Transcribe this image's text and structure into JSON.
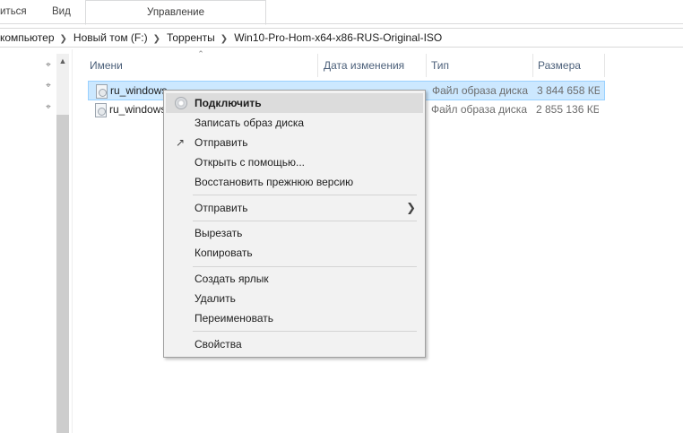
{
  "ribbon": {
    "tabs": [
      "иться",
      "Вид",
      "Управление"
    ]
  },
  "address": {
    "crumbs": [
      "компьютер",
      "Новый том (F:)",
      "Торренты",
      "Win10-Pro-Hom-x64-x86-RUS-Original-ISO"
    ]
  },
  "columns": {
    "name": "Имени",
    "date": "Дата изменения",
    "type": "Тип",
    "size": "Размера"
  },
  "files": [
    {
      "name": "ru_windows",
      "type": "Файл образа диска",
      "size": "3 844 658 КБ",
      "selected": true
    },
    {
      "name": "ru_windows",
      "type": "Файл образа диска",
      "size": "2 855 136 КБ",
      "selected": false
    }
  ],
  "context_menu": {
    "items": [
      {
        "label": "Подключить",
        "icon": "disc-icon"
      },
      {
        "label": "Записать образ диска"
      },
      {
        "label": "Отправить",
        "icon": "share-icon"
      },
      {
        "label": "Открыть с помощью..."
      },
      {
        "label": "Восстановить прежнюю версию"
      },
      {
        "label": "Отправить",
        "submenu": true
      },
      {
        "label": "Вырезать"
      },
      {
        "label": "Копировать"
      },
      {
        "label": "Создать ярлык"
      },
      {
        "label": "Удалить"
      },
      {
        "label": "Переименовать"
      },
      {
        "label": "Свойства"
      }
    ]
  },
  "colors": {
    "selection_bg": "#cce8ff",
    "selection_border": "#99d1ff",
    "header_text": "#4c607a",
    "menu_bg": "#f2f2f2",
    "menu_highlight": "#dcdcdc"
  }
}
